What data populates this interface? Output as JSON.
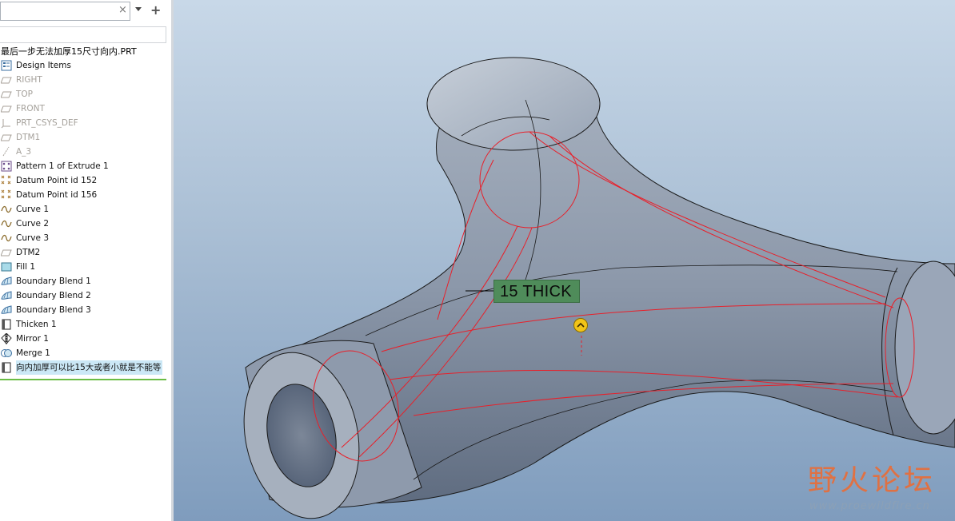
{
  "search": {
    "clear_icon": "×",
    "add_icon": "+"
  },
  "model_tree": {
    "model_name": "最后一步无法加厚15尺寸向内.PRT",
    "items": [
      {
        "label": "Design Items",
        "icon": "design-items-icon",
        "suppressed": false,
        "selected": false
      },
      {
        "label": "RIGHT",
        "icon": "datum-plane-icon",
        "suppressed": true,
        "selected": false
      },
      {
        "label": "TOP",
        "icon": "datum-plane-icon",
        "suppressed": true,
        "selected": false
      },
      {
        "label": "FRONT",
        "icon": "datum-plane-icon",
        "suppressed": true,
        "selected": false
      },
      {
        "label": "PRT_CSYS_DEF",
        "icon": "csys-icon",
        "suppressed": true,
        "selected": false
      },
      {
        "label": "DTM1",
        "icon": "datum-plane-icon",
        "suppressed": true,
        "selected": false
      },
      {
        "label": "A_3",
        "icon": "datum-axis-icon",
        "suppressed": true,
        "selected": false
      },
      {
        "label": "Pattern 1 of Extrude 1",
        "icon": "pattern-icon",
        "suppressed": false,
        "selected": false
      },
      {
        "label": "Datum Point id 152",
        "icon": "datum-point-icon",
        "suppressed": false,
        "selected": false
      },
      {
        "label": "Datum Point id 156",
        "icon": "datum-point-icon",
        "suppressed": false,
        "selected": false
      },
      {
        "label": "Curve 1",
        "icon": "curve-icon",
        "suppressed": false,
        "selected": false
      },
      {
        "label": "Curve 2",
        "icon": "curve-icon",
        "suppressed": false,
        "selected": false
      },
      {
        "label": "Curve 3",
        "icon": "curve-icon",
        "suppressed": false,
        "selected": false
      },
      {
        "label": "DTM2",
        "icon": "datum-plane-icon",
        "suppressed": false,
        "selected": false
      },
      {
        "label": "Fill 1",
        "icon": "fill-icon",
        "suppressed": false,
        "selected": false
      },
      {
        "label": "Boundary Blend 1",
        "icon": "boundary-blend-icon",
        "suppressed": false,
        "selected": false
      },
      {
        "label": "Boundary Blend 2",
        "icon": "boundary-blend-icon",
        "suppressed": false,
        "selected": false
      },
      {
        "label": "Boundary Blend 3",
        "icon": "boundary-blend-icon",
        "suppressed": false,
        "selected": false
      },
      {
        "label": "Thicken 1",
        "icon": "thicken-icon",
        "suppressed": false,
        "selected": false
      },
      {
        "label": "Mirror 1",
        "icon": "mirror-icon",
        "suppressed": false,
        "selected": false
      },
      {
        "label": "Merge 1",
        "icon": "merge-icon",
        "suppressed": false,
        "selected": false
      },
      {
        "label": "向内加厚可以比15大或者小就是不能等",
        "icon": "thicken-icon",
        "suppressed": false,
        "selected": true
      }
    ]
  },
  "viewport": {
    "dimension_label": "15 THICK",
    "flip_icon": "flip-direction-icon",
    "watermark_text": "野火论坛",
    "watermark_url": "www.proewildfire.cn",
    "colors": {
      "model_shade": "#9aa6b6",
      "preview_curves": "#e8202a",
      "dimension_bg": "#4f8c5a"
    }
  }
}
